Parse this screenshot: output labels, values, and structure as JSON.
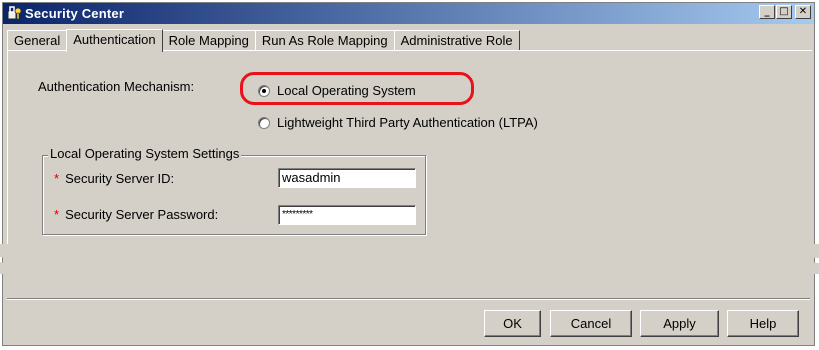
{
  "window": {
    "title": "Security Center",
    "controls": {
      "minimize": "_",
      "maximize": "□",
      "close": "✕"
    }
  },
  "tabs": [
    {
      "label": "General",
      "active": false
    },
    {
      "label": "Authentication",
      "active": true
    },
    {
      "label": "Role Mapping",
      "active": false
    },
    {
      "label": "Run As Role Mapping",
      "active": false
    },
    {
      "label": "Administrative Role",
      "active": false
    }
  ],
  "authentication": {
    "mechanism_label": "Authentication Mechanism:",
    "options": [
      {
        "label": "Local Operating System",
        "selected": true
      },
      {
        "label": "Lightweight Third Party Authentication (LTPA)",
        "selected": false
      }
    ],
    "highlight_color": "#e8121a"
  },
  "local_os_settings": {
    "legend": "Local Operating System Settings",
    "required_marker": "*",
    "server_id_label": "Security Server ID:",
    "server_id_value": "wasadmin",
    "password_label": "Security Server Password:",
    "password_value": "*********"
  },
  "buttons": {
    "ok": "OK",
    "cancel": "Cancel",
    "apply": "Apply",
    "help": "Help"
  }
}
